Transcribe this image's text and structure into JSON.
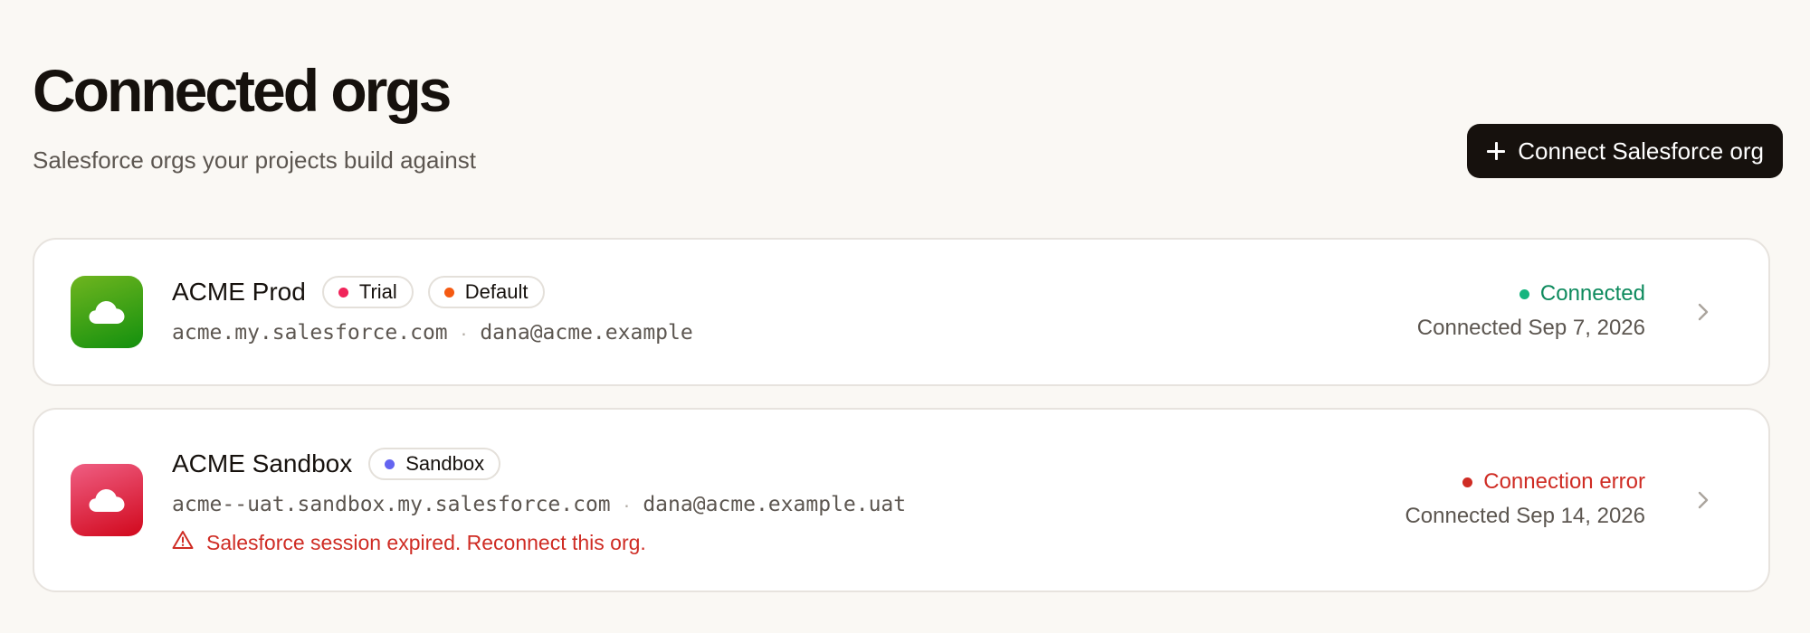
{
  "header": {
    "title": "Connected orgs",
    "subtitle": "Salesforce orgs your projects build against",
    "connect_button_label": "Connect Salesforce org"
  },
  "orgs": [
    {
      "name": "ACME Prod",
      "icon": "cloud-icon",
      "icon_color": "#13900e",
      "badges": [
        {
          "label": "Trial",
          "dot_color": "#f0245a"
        },
        {
          "label": "Default",
          "dot_color": "#f55a12"
        }
      ],
      "domain": "acme.my.salesforce.com",
      "separator": "·",
      "user": "dana@acme.example",
      "status": "Connected",
      "status_color": "#0d8a5d",
      "connected_date": "Connected Sep 7, 2026"
    },
    {
      "name": "ACME Sandbox",
      "icon": "cloud-icon",
      "icon_color": "#d1081c",
      "badges": [
        {
          "label": "Sandbox",
          "dot_color": "#6464f0"
        }
      ],
      "domain": "acme--uat.sandbox.my.salesforce.com",
      "separator": "·",
      "user": "dana@acme.example.uat",
      "error_message": "Salesforce session expired. Reconnect this org.",
      "status": "Connection error",
      "status_color": "#cf2c24",
      "connected_date": "Connected Sep 14, 2026"
    }
  ]
}
